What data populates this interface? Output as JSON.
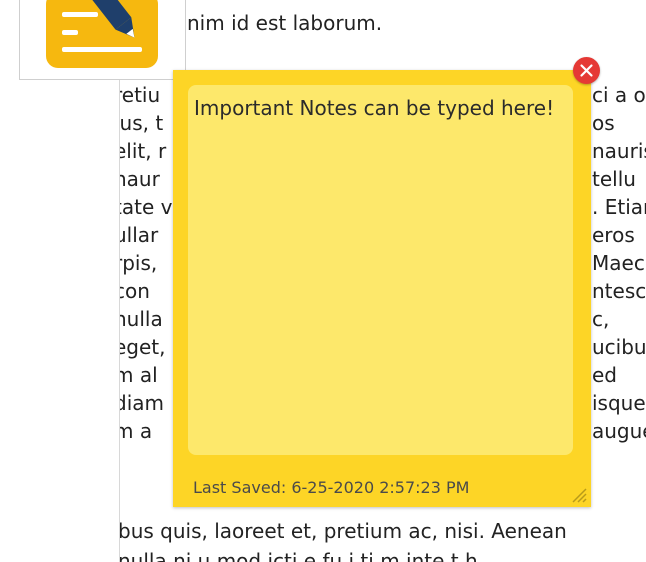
{
  "document": {
    "top_line": "nim id est laborum.",
    "left_fragments": [
      "retiu",
      "ius, t",
      "elit, r",
      "naur",
      "tate v",
      "ullar",
      "rpis,",
      " con",
      "nulla",
      "eget,",
      "m al",
      "diam",
      "m a"
    ],
    "right_fragments": [
      "ci a o",
      "os",
      "nauris",
      "tellu",
      ". Etiar",
      "eros",
      "Maece",
      "ntesc",
      "c,",
      "ucibu",
      "ed",
      "isque",
      "augue"
    ],
    "bottom_line": "bus quis, laoreet et, pretium ac, nisi. Aenean",
    "cut_line": "nulla ni u mod    icti                                      e fu    i ti m   inte    t h"
  },
  "app": {
    "icon": "notes-pencil-icon",
    "icon_color": "#f6b80f"
  },
  "note": {
    "text": "Important Notes can be typed here!",
    "last_saved": "Last Saved: 6-25-2020 2:57:23 PM",
    "colors": {
      "background": "#fdd526",
      "text_area": "#fde86b",
      "close": "#e53935"
    }
  },
  "controls": {
    "close_icon": "close-icon",
    "resize_icon": "resize-grip-icon"
  }
}
